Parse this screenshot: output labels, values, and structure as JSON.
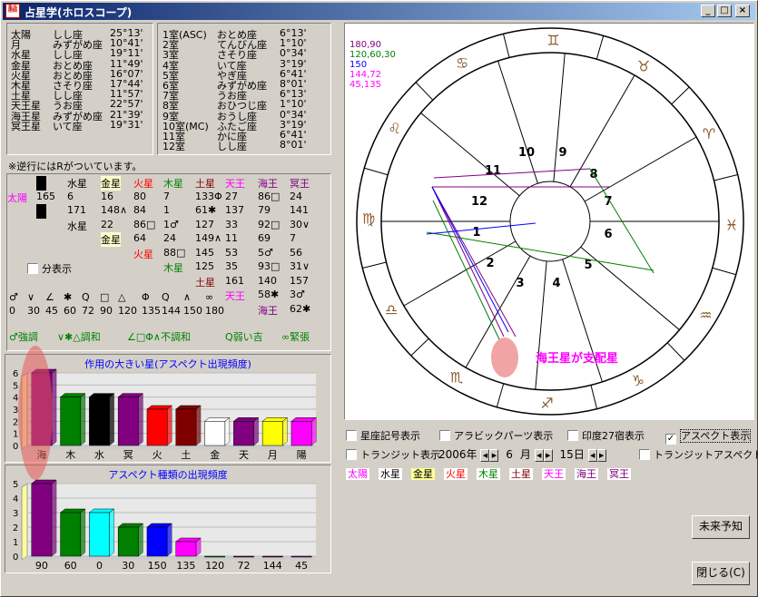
{
  "window": {
    "title": "占星学(ホロスコープ)",
    "icon_text": "星占術師"
  },
  "planets_table": [
    {
      "name": "太陽",
      "sign": "しし座",
      "deg": "25°13'"
    },
    {
      "name": "月",
      "sign": "みずがめ座",
      "deg": "10°41'"
    },
    {
      "name": "水星",
      "sign": "しし座",
      "deg": "19°11'"
    },
    {
      "name": "金星",
      "sign": "おとめ座",
      "deg": "11°49'"
    },
    {
      "name": "火星",
      "sign": "おとめ座",
      "deg": "16°07'"
    },
    {
      "name": "木星",
      "sign": "さそり座",
      "deg": "17°44'"
    },
    {
      "name": "土星",
      "sign": "しし座",
      "deg": "11°57'"
    },
    {
      "name": "天王星",
      "sign": "うお座",
      "deg": "22°57'"
    },
    {
      "name": "海王星",
      "sign": "みずがめ座",
      "deg": "21°39'"
    },
    {
      "name": "冥王星",
      "sign": "いて座",
      "deg": "19°31'"
    }
  ],
  "houses_table": [
    {
      "name": "1室(ASC)",
      "sign": "おとめ座",
      "deg": "6°13'"
    },
    {
      "name": "2室",
      "sign": "てんびん座",
      "deg": "1°10'"
    },
    {
      "name": "3室",
      "sign": "さそり座",
      "deg": "0°34'"
    },
    {
      "name": "4室",
      "sign": "いて座",
      "deg": "3°19'"
    },
    {
      "name": "5室",
      "sign": "やぎ座",
      "deg": "6°41'"
    },
    {
      "name": "6室",
      "sign": "みずがめ座",
      "deg": "8°01'"
    },
    {
      "name": "7室",
      "sign": "うお座",
      "deg": "6°13'"
    },
    {
      "name": "8室",
      "sign": "おひつじ座",
      "deg": "1°10'"
    },
    {
      "name": "9室",
      "sign": "おうし座",
      "deg": "0°34'"
    },
    {
      "name": "10室(MC)",
      "sign": "ふたご座",
      "deg": "3°19'"
    },
    {
      "name": "11室",
      "sign": "かに座",
      "deg": "6°41'"
    },
    {
      "name": "12室",
      "sign": "しし座",
      "deg": "8°01'"
    }
  ],
  "retro_note": "※逆行にはRがついています。",
  "aspect_matrix": {
    "col_headers": [
      "月",
      "水星",
      "金星",
      "火星",
      "木星",
      "土星",
      "天王",
      "海王",
      "冥王"
    ],
    "row1_label": "太陽",
    "row1": [
      "165",
      "6",
      "16",
      "80",
      "7",
      "133Φ",
      "27",
      "86□",
      "24"
    ],
    "row2_label": "月",
    "row2": [
      "171",
      "148∧",
      "84",
      "1",
      "61✱",
      "137",
      "79",
      "141"
    ],
    "row3_label": "水星",
    "row3": [
      "22",
      "86□",
      "1♂",
      "127",
      "33",
      "92□",
      "30∨"
    ],
    "row4_label": "金星",
    "row4": [
      "64",
      "24",
      "149∧",
      "11",
      "69",
      "7"
    ],
    "row5_label": "火星",
    "row5": [
      "88□",
      "145",
      "53",
      "5♂",
      "56"
    ],
    "row6_label": "木星",
    "row6": [
      "125",
      "35",
      "93□",
      "31∨"
    ],
    "row7_label": "土星",
    "row7": [
      "161",
      "140",
      "157"
    ],
    "row8_label": "天王",
    "row8": [
      "58✱",
      "3♂"
    ],
    "row9_label": "海王",
    "row9": [
      "62✱"
    ]
  },
  "split_checkbox": "分表示",
  "aspect_symbols": [
    "♂",
    "∨",
    "∠",
    "✱",
    "Q",
    "□",
    "△",
    "Φ",
    "Q",
    "∧",
    "∞"
  ],
  "aspect_angles": [
    "0",
    "30",
    "45",
    "60",
    "72",
    "90",
    "120",
    "135",
    "144",
    "150",
    "180"
  ],
  "aspect_legend": [
    "♂強調",
    "∨✱△調和",
    "∠□Φ∧不調和",
    "Q弱い吉",
    "∞緊張"
  ],
  "chart1": {
    "title": "作用の大きい星(アスペクト出現頻度)",
    "type": "bar",
    "ylim": [
      0,
      6
    ],
    "yticks": [
      "0",
      "1",
      "2",
      "3",
      "4",
      "5",
      "6"
    ],
    "categories": [
      "海",
      "木",
      "水",
      "冥",
      "火",
      "土",
      "金",
      "天",
      "月",
      "陽"
    ],
    "values": [
      6,
      4,
      4,
      4,
      3,
      3,
      2,
      2,
      2,
      2
    ],
    "colors": [
      "#800080",
      "#008000",
      "#000000",
      "#800080",
      "#ff0000",
      "#800000",
      "#ffffff",
      "#800080",
      "#ffff00",
      "#ff00ff"
    ]
  },
  "chart2": {
    "title": "アスペクト種類の出現頻度",
    "type": "bar",
    "ylim": [
      0,
      5
    ],
    "yticks": [
      "0",
      "1",
      "2",
      "3",
      "4",
      "5"
    ],
    "categories": [
      "90",
      "60",
      "0",
      "30",
      "150",
      "135",
      "120",
      "72",
      "144",
      "45"
    ],
    "values": [
      5,
      3,
      3,
      2,
      2,
      1,
      0,
      0,
      0,
      0
    ],
    "colors": [
      "#800080",
      "#008000",
      "#00ffff",
      "#008000",
      "#0000ff",
      "#ff00ff",
      "#008000",
      "#800000",
      "#800000",
      "#800080"
    ]
  },
  "chart_data": [
    {
      "type": "bar",
      "title": "作用の大きい星(アスペクト出現頻度)",
      "categories": [
        "海",
        "木",
        "水",
        "冥",
        "火",
        "土",
        "金",
        "天",
        "月",
        "陽"
      ],
      "values": [
        6,
        4,
        4,
        4,
        3,
        3,
        2,
        2,
        2,
        2
      ],
      "ylim": [
        0,
        6
      ]
    },
    {
      "type": "bar",
      "title": "アスペクト種類の出現頻度",
      "categories": [
        "90",
        "60",
        "0",
        "30",
        "150",
        "135",
        "120",
        "72",
        "144",
        "45"
      ],
      "values": [
        5,
        3,
        3,
        2,
        2,
        1,
        0,
        0,
        0,
        0
      ],
      "ylim": [
        0,
        5
      ]
    }
  ],
  "chart_legend_angles": [
    {
      "text": "180,90",
      "color": "#800080"
    },
    {
      "text": "120,60,30",
      "color": "#008000"
    },
    {
      "text": "150",
      "color": "#0000ff"
    },
    {
      "text": "144,72",
      "color": "#ff00ff"
    },
    {
      "text": "45,135",
      "color": "#ff00ff"
    }
  ],
  "houses_numbers": [
    "1",
    "2",
    "3",
    "4",
    "5",
    "6",
    "7",
    "8",
    "9",
    "10",
    "11",
    "12"
  ],
  "annotation": "海王星が支配星",
  "options": {
    "sign_symbols": "星座記号表示",
    "arabic_parts": "アラビックパーツ表示",
    "lunar_mansions": "印度27宿表示",
    "aspect_display": "アスペクト表示",
    "transit": "トランジット表示",
    "year": "2006",
    "year_unit": "年",
    "month": "6",
    "month_unit": "月",
    "day": "15",
    "day_unit": "日",
    "transit_aspect": "トランジットアスペクト表示"
  },
  "planet_tags": [
    {
      "label": "太陽",
      "color": "#ff00ff",
      "bg": "#ffffff"
    },
    {
      "label": "水星",
      "color": "#000000",
      "bg": "#ffffff"
    },
    {
      "label": "金星",
      "color": "#000000",
      "bg": "#ffff99"
    },
    {
      "label": "火星",
      "color": "#ff0000",
      "bg": "#ffffff"
    },
    {
      "label": "木星",
      "color": "#008000",
      "bg": "#ffffff"
    },
    {
      "label": "土星",
      "color": "#800000",
      "bg": "#ffffff"
    },
    {
      "label": "天王",
      "color": "#ff00ff",
      "bg": "#ffffff"
    },
    {
      "label": "海王",
      "color": "#800080",
      "bg": "#ffffff"
    },
    {
      "label": "冥王",
      "color": "#800080",
      "bg": "#ffffff"
    }
  ],
  "buttons": {
    "forecast": "未来予知",
    "close": "閉じる(C)"
  }
}
